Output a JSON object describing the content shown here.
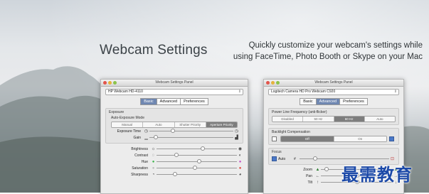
{
  "hero": {
    "title": "Webcam Settings",
    "subtitle_line1": "Quickly customize your webcam's settings while",
    "subtitle_line2": "using FaceTime, Photo Booth or Skype on your Mac"
  },
  "panel1": {
    "window_title": "Webcam Settings Panel",
    "camera": "HP Webcam HD-4110",
    "tabs": [
      "Basic",
      "Advanced",
      "Preferences"
    ],
    "selected_tab": "Basic",
    "exposure_group": "Exposure",
    "auto_exposure_label": "Auto-Exposure Mode",
    "exposure_modes": [
      "Manual",
      "Auto",
      "Shutter Priority",
      "Aperture Priority"
    ],
    "selected_mode": "Aperture Priority",
    "exposure_time_label": "Exposure Time",
    "gain_label": "Gain",
    "image_sliders": [
      {
        "label": "Brightness",
        "value": 0.55
      },
      {
        "label": "Contrast",
        "value": 0.22
      },
      {
        "label": "Hue",
        "value": 0.5
      },
      {
        "label": "Saturation",
        "value": 0.45
      },
      {
        "label": "Sharpness",
        "value": 0.2
      }
    ]
  },
  "panel2": {
    "window_title": "Webcam Settings Panel",
    "camera": "Logitech Camera HD Pro Webcam C920",
    "tabs": [
      "Basic",
      "Advanced",
      "Preferences"
    ],
    "selected_tab": "Advanced",
    "power_line_label": "Power Line Frequency (anti-flicker)",
    "power_line_options": [
      "Disabled",
      "50 Hz",
      "60 Hz",
      "Auto"
    ],
    "power_line_selected": "60 Hz",
    "backlight_label": "Backlight Compensation",
    "backlight_options": [
      "Off",
      "On"
    ],
    "backlight_selected": "Off",
    "focus_label": "Focus",
    "focus_auto_label": "Auto",
    "focus_auto_checked": true,
    "hash_symbol": "#",
    "zoom_label": "Zoom",
    "pan_label": "Pan",
    "tilt_label": "Tilt"
  },
  "watermark": "最需教育",
  "colors": {
    "selected_tab": "#6f87b1",
    "selected_segment": "#7d7d7d",
    "watermark": "#1d4aa8"
  }
}
